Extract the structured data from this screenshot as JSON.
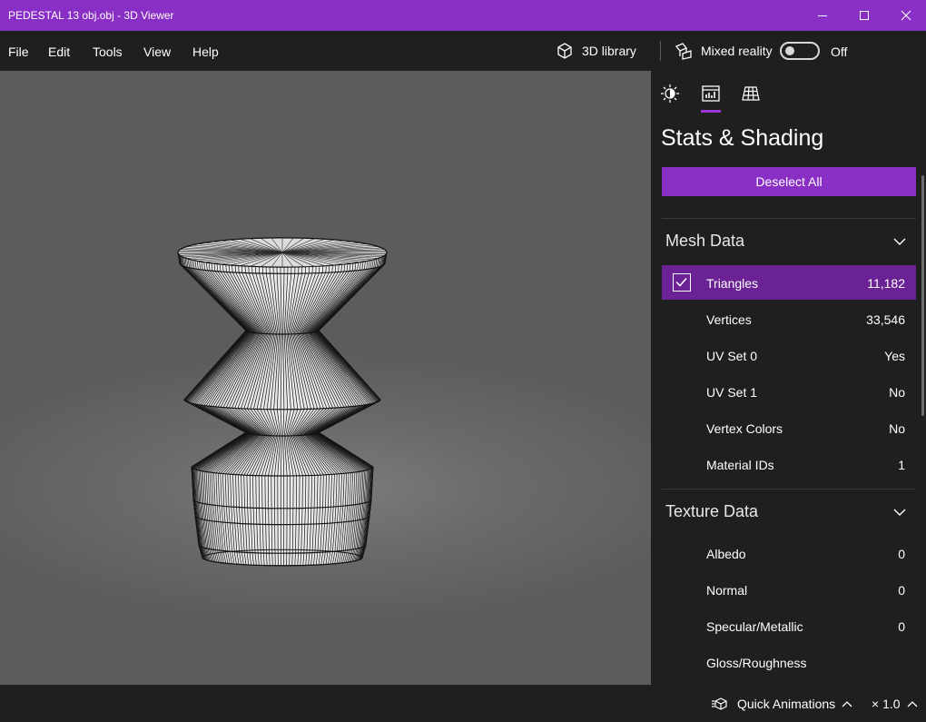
{
  "window": {
    "title": "PEDESTAL 13 obj.obj - 3D Viewer",
    "accent_color": "#8a2fc6"
  },
  "menu": {
    "items": [
      "File",
      "Edit",
      "Tools",
      "View",
      "Help"
    ]
  },
  "toolbar": {
    "library_label": "3D library",
    "mixed_reality_label": "Mixed reality",
    "mixed_reality_state": "Off"
  },
  "panel": {
    "tabs": [
      "lighting-icon",
      "stats-icon",
      "grid-icon"
    ],
    "active_tab": "stats-icon",
    "title": "Stats & Shading",
    "deselect_label": "Deselect All",
    "mesh": {
      "title": "Mesh Data",
      "rows": [
        {
          "label": "Triangles",
          "value": "11,182",
          "checked": true
        },
        {
          "label": "Vertices",
          "value": "33,546"
        },
        {
          "label": "UV Set 0",
          "value": "Yes"
        },
        {
          "label": "UV Set 1",
          "value": "No"
        },
        {
          "label": "Vertex Colors",
          "value": "No"
        },
        {
          "label": "Material IDs",
          "value": "1"
        }
      ]
    },
    "texture": {
      "title": "Texture Data",
      "rows": [
        {
          "label": "Albedo",
          "value": "0"
        },
        {
          "label": "Normal",
          "value": "0"
        },
        {
          "label": "Specular/Metallic",
          "value": "0"
        },
        {
          "label": "Gloss/Roughness",
          "value": ""
        }
      ]
    }
  },
  "statusbar": {
    "animations_label": "Quick Animations",
    "speed": "× 1.0"
  }
}
